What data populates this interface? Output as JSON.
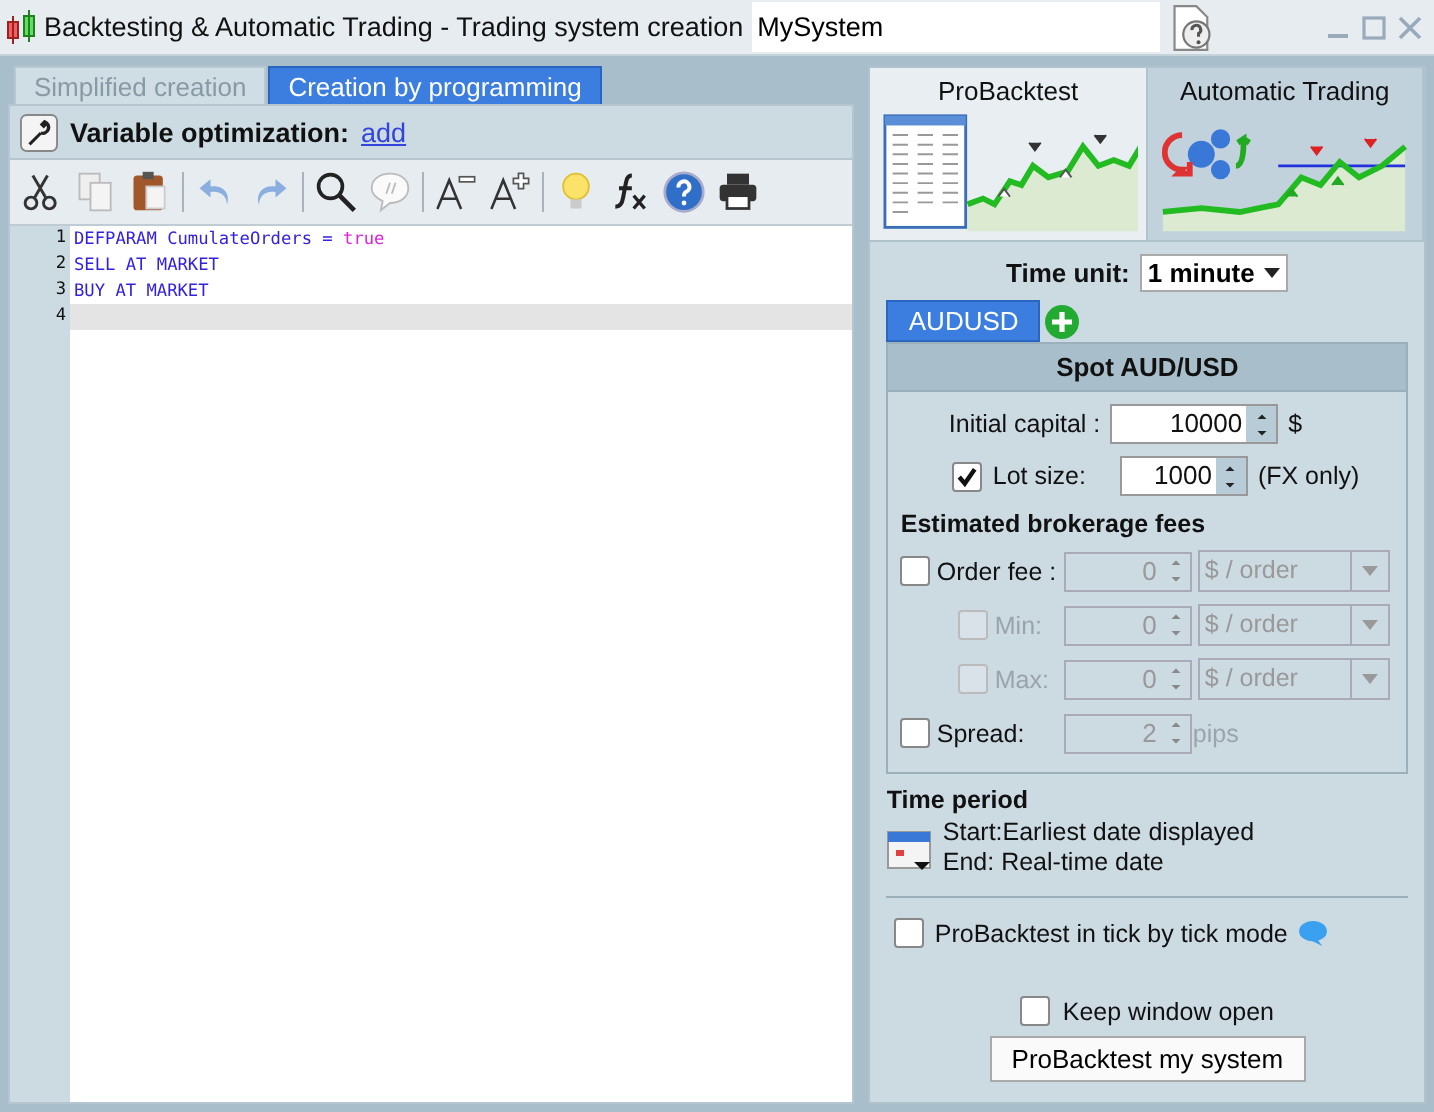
{
  "window": {
    "title": "Backtesting & Automatic Trading - Trading system creation",
    "system_name": "MySystem"
  },
  "tabs": [
    {
      "label": "Simplified creation",
      "selected": false
    },
    {
      "label": "Creation by programming",
      "selected": true
    }
  ],
  "optimization": {
    "label": "Variable optimization:",
    "link": "add"
  },
  "code": [
    {
      "number": "1",
      "current": false,
      "tokens": [
        {
          "kind": "keyword",
          "text": "DEFPARAM CumulateOrders = "
        },
        {
          "kind": "value",
          "text": "true"
        }
      ]
    },
    {
      "number": "2",
      "current": false,
      "tokens": [
        {
          "kind": "keyword",
          "text": "SELL AT MARKET"
        }
      ]
    },
    {
      "number": "3",
      "current": false,
      "tokens": [
        {
          "kind": "keyword",
          "text": "BUY AT MARKET"
        }
      ]
    },
    {
      "number": "4",
      "current": true
    }
  ],
  "mode_tabs": [
    {
      "label": "ProBacktest",
      "selected": true
    },
    {
      "label": "Automatic Trading",
      "selected": false
    }
  ],
  "time_unit": {
    "label": "Time unit:",
    "value": "1 minute"
  },
  "instrument_tabs": [
    {
      "label": "AUDUSD",
      "selected": true
    }
  ],
  "instrument": {
    "title": "Spot AUD/USD",
    "initial_capital": {
      "label": "Initial capital :",
      "value": "10000",
      "unit": "$"
    },
    "lot_size": {
      "label": "Lot size:",
      "checked": true,
      "value": "1000",
      "note": "(FX only)"
    },
    "fees_heading": "Estimated brokerage fees",
    "fees": [
      {
        "kind": "dropdown",
        "label": "Order fee :",
        "checked": false,
        "disabled": false,
        "value": "0",
        "unit": "$ / order"
      },
      {
        "kind": "dropdown",
        "label": "Min:",
        "checked": false,
        "disabled": true,
        "value": "0",
        "unit": "$ / order"
      },
      {
        "kind": "dropdown",
        "label": "Max:",
        "checked": false,
        "disabled": true,
        "value": "0",
        "unit": "$ / order"
      },
      {
        "kind": "text",
        "label": "Spread:",
        "checked": false,
        "disabled": false,
        "value": "2",
        "unit": "pips"
      }
    ]
  },
  "time_period": {
    "heading": "Time period",
    "start": "Start:Earliest date displayed",
    "end": "End: Real-time date"
  },
  "tick_mode": {
    "label": "ProBacktest in tick by tick mode",
    "checked": false
  },
  "keep_open": {
    "label": "Keep window open",
    "checked": false
  },
  "run_button": "ProBacktest my system"
}
